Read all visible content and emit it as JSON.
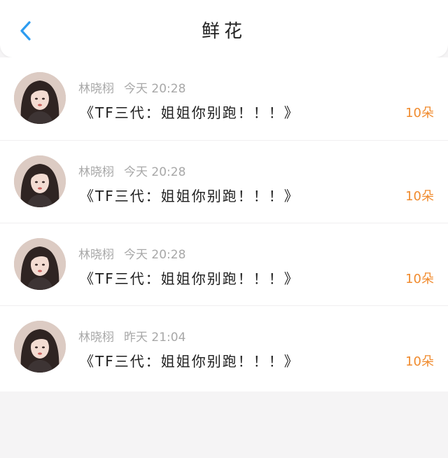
{
  "header": {
    "title": "鲜花",
    "back_icon": "chevron-left-icon",
    "back_color": "#2d9cf0"
  },
  "accent_color": "#f08b2e",
  "list": [
    {
      "name": "林晓栩",
      "time": "今天 20:28",
      "message": "《TF三代：姐姐你别跑！！！》",
      "amount": "10朵"
    },
    {
      "name": "林晓栩",
      "time": "今天 20:28",
      "message": "《TF三代：姐姐你别跑！！！》",
      "amount": "10朵"
    },
    {
      "name": "林晓栩",
      "time": "今天 20:28",
      "message": "《TF三代：姐姐你别跑！！！》",
      "amount": "10朵"
    },
    {
      "name": "林晓栩",
      "time": "昨天 21:04",
      "message": "《TF三代：姐姐你别跑！！！》",
      "amount": "10朵"
    }
  ]
}
